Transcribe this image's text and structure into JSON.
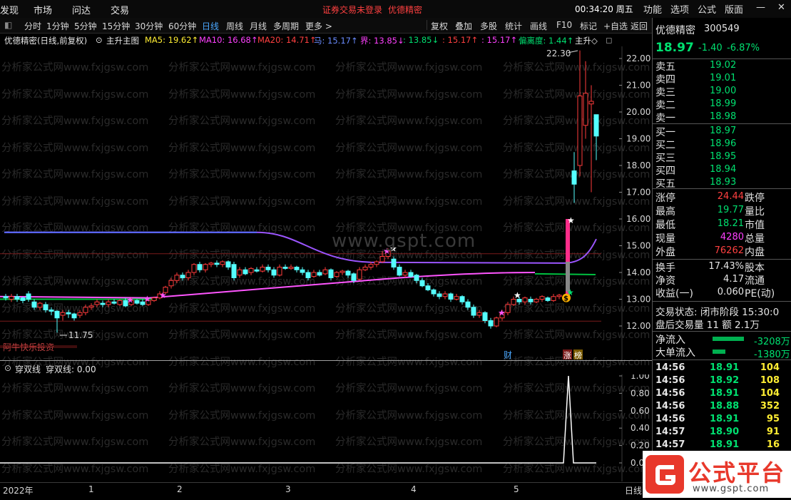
{
  "menu": [
    "发现",
    "市场",
    "问达",
    "交易"
  ],
  "status": {
    "login": "证券交易未登录",
    "title": "优德精密",
    "clock": "00:34:20 周五"
  },
  "window_menu": [
    "功能",
    "选项",
    "公式",
    "版面"
  ],
  "toolbar": {
    "periods": [
      "分时",
      "1分钟",
      "5分钟",
      "15分钟",
      "30分钟",
      "60分钟",
      "日线",
      "周线",
      "月线",
      "多周期",
      "更多 >"
    ],
    "active": "日线",
    "right_buttons": [
      "复权",
      "叠加",
      "多股",
      "统计",
      "画线",
      "F10",
      "标记",
      "+自选",
      "返回"
    ]
  },
  "info_line": {
    "name": "优德精密(日线,前复权)",
    "main_label": "主升主图",
    "ma5": "MA5: 19.62↑",
    "ma10": "MA10: 16.68↑",
    "ma20": "MA20: 14.71↑",
    "ma_horse": "马: 15.17↑",
    "ma_bound": "界: 13.85↓",
    "v1": ": 13.85↓",
    "v2": ": 15.17↑",
    "v3": ": 15.17↑",
    "deviation": "偏离度: 1.44↑",
    "zhusheng": "主升◇",
    "colors": {
      "ma5": "#ffee33",
      "ma10": "#ff40ff",
      "ma20": "#ff4040",
      "horse": "#6a8cff",
      "bound": "#ff40ff",
      "v1": "#00e070",
      "v2": "#ff4040",
      "v3": "#ff40ff",
      "dev": "#00e070",
      "zs": "#e6e6e6"
    }
  },
  "price_axis": [
    "22.00",
    "21.00",
    "20.00",
    "19.00",
    "18.00",
    "17.00",
    "16.00",
    "15.00",
    "14.00",
    "13.00",
    "12.00"
  ],
  "annotations": {
    "high": "22.30",
    "low": "11.75",
    "label": "阿牛快乐投资",
    "cai": "财",
    "zhang": "涨",
    "bang": "榜",
    "money": "$",
    "site": "www.gspt.com"
  },
  "watermark_text": "分析家公式网www.fxjgsw.com",
  "sub_indicator": {
    "name": "穿双线",
    "value": "穿双线: 0.00",
    "axis": [
      "1.00",
      "0.80",
      "0.60",
      "0.40",
      "0.20",
      "0.00"
    ]
  },
  "x_axis": [
    "2022年",
    "1",
    "2",
    "3",
    "4",
    "5",
    "日线"
  ],
  "quote": {
    "name": "优德精密",
    "code": "300549",
    "price": "18.97",
    "change": "-1.40",
    "pct": "-6.87%",
    "asks": [
      {
        "label": "卖五",
        "price": "19.02"
      },
      {
        "label": "卖四",
        "price": "19.01"
      },
      {
        "label": "卖三",
        "price": "19.00"
      },
      {
        "label": "卖二",
        "price": "18.99"
      },
      {
        "label": "卖一",
        "price": "18.98"
      }
    ],
    "bids": [
      {
        "label": "买一",
        "price": "18.97"
      },
      {
        "label": "买二",
        "price": "18.96"
      },
      {
        "label": "买三",
        "price": "18.95"
      },
      {
        "label": "买四",
        "price": "18.94"
      },
      {
        "label": "买五",
        "price": "18.93"
      }
    ],
    "stats": [
      {
        "l1": "涨停",
        "v1": "24.44",
        "c1": "red",
        "l2": "跌停"
      },
      {
        "l1": "最高",
        "v1": "19.77",
        "c1": "green",
        "l2": "量比"
      },
      {
        "l1": "最低",
        "v1": "18.21",
        "c1": "green",
        "l2": "市值"
      },
      {
        "l1": "现量",
        "v1": "4280",
        "c1": "magenta",
        "l2": "总量"
      },
      {
        "l1": "外盘",
        "v1": "76262",
        "c1": "red",
        "l2": "内盘"
      }
    ],
    "fin": [
      {
        "l1": "换手",
        "v1": "17.43%",
        "l2": "股本"
      },
      {
        "l1": "净资",
        "v1": "4.17",
        "l2": "流通"
      },
      {
        "l1": "收益(一)",
        "v1": "0.060",
        "l2": "PE(动)"
      }
    ],
    "trade_status": "交易状态: 闭市阶段 15:30:0",
    "after_hours": "盘后交易量 11 额 2.1万",
    "net_inflow": {
      "label": "净流入",
      "value": "-3208万"
    },
    "big_inflow": {
      "label": "大单流入",
      "value": "-1380万"
    },
    "ticks": [
      {
        "t": "14:56",
        "p": "18.91",
        "v": "104"
      },
      {
        "t": "14:56",
        "p": "18.92",
        "v": "108"
      },
      {
        "t": "14:56",
        "p": "18.91",
        "v": "104"
      },
      {
        "t": "14:56",
        "p": "18.88",
        "v": "352"
      },
      {
        "t": "14:56",
        "p": "18.91",
        "v": "95"
      },
      {
        "t": "14:57",
        "p": "18.90",
        "v": "91"
      },
      {
        "t": "14:57",
        "p": "18.91",
        "v": "16"
      }
    ]
  },
  "logo": {
    "text": "公式平台",
    "url": "www.gspt.com"
  }
}
